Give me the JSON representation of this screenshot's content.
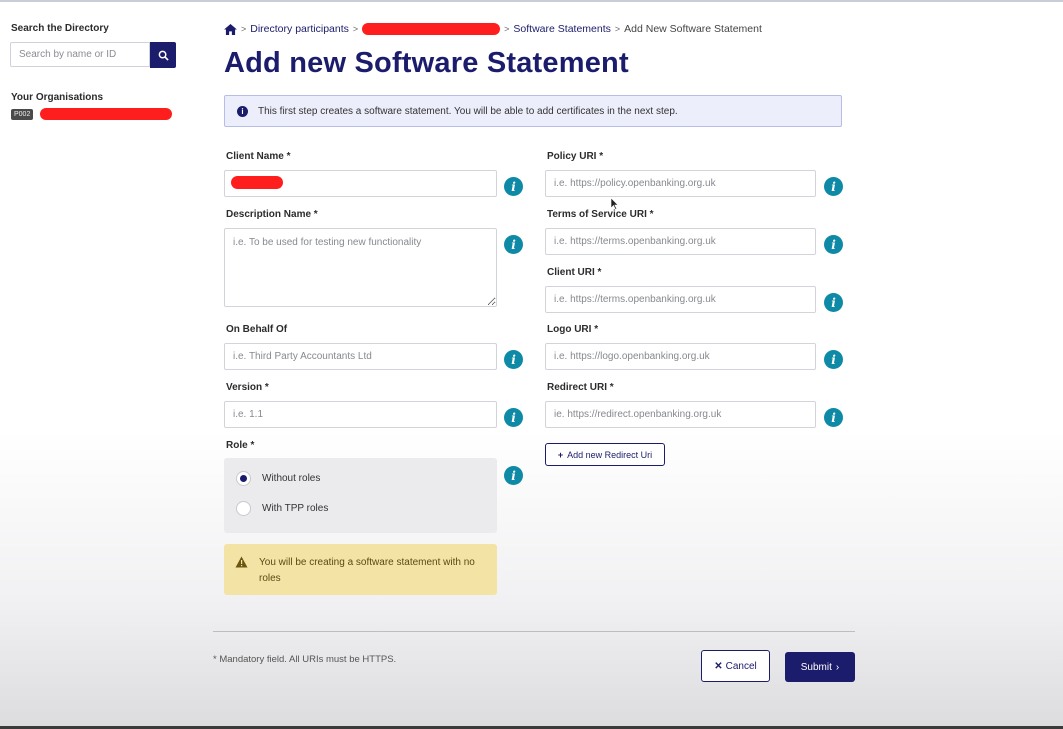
{
  "sidebar": {
    "search_title": "Search the Directory",
    "search_placeholder": "Search by name or ID",
    "orgs_title": "Your Organisations",
    "org_badge": "P002"
  },
  "breadcrumb": {
    "home_icon": "home-icon",
    "items": [
      "Directory participants",
      "Software Statements",
      "Add New Software Statement"
    ]
  },
  "page": {
    "title": "Add new Software Statement",
    "info": "This first step creates a software statement. You will be able to add certificates in the next step."
  },
  "form": {
    "client_name": {
      "label": "Client Name *"
    },
    "description": {
      "label": "Description Name *",
      "placeholder": "i.e. To be used for testing new functionality"
    },
    "on_behalf_of": {
      "label": "On Behalf Of",
      "placeholder": "i.e. Third Party Accountants Ltd"
    },
    "version": {
      "label": "Version *",
      "placeholder": "i.e. 1.1"
    },
    "role": {
      "label": "Role *",
      "options": [
        "Without roles",
        "With TPP roles"
      ],
      "selected": "Without roles"
    },
    "warning": "You will be creating a software statement with no roles",
    "policy_uri": {
      "label": "Policy URI *",
      "placeholder": "i.e. https://policy.openbanking.org.uk"
    },
    "tos_uri": {
      "label": "Terms of Service URI *",
      "placeholder": "i.e. https://terms.openbanking.org.uk"
    },
    "client_uri": {
      "label": "Client URI *",
      "placeholder": "i.e. https://terms.openbanking.org.uk"
    },
    "logo_uri": {
      "label": "Logo URI *",
      "placeholder": "i.e. https://logo.openbanking.org.uk"
    },
    "redirect_uri": {
      "label": "Redirect URI *",
      "placeholder": "ie. https://redirect.openbanking.org.uk"
    },
    "add_redirect_label": "Add new Redirect Uri"
  },
  "footer": {
    "note": "* Mandatory field. All URIs must be HTTPS.",
    "cancel_label": "Cancel",
    "submit_label": "Submit"
  },
  "colors": {
    "brand": "#1b1c6b",
    "info_icon": "#0f8aa6",
    "warning_bg": "#f3e3a4",
    "redaction": "#ff1e1e"
  }
}
